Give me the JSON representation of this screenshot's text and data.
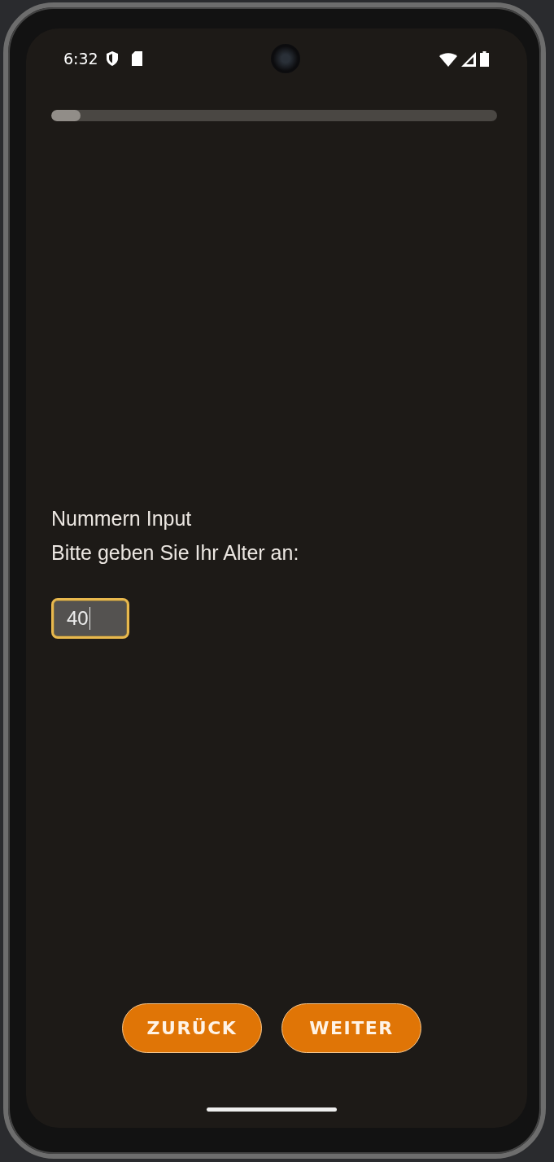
{
  "status_bar": {
    "time": "6:32"
  },
  "progress": {
    "level": 0.065
  },
  "question": {
    "title": "Nummern Input",
    "prompt": "Bitte geben Sie Ihr Alter an:"
  },
  "answer": {
    "value": "40",
    "focused": true
  },
  "buttons": [
    {
      "label": "ZURÜCK"
    },
    {
      "label": "WEITER"
    }
  ]
}
